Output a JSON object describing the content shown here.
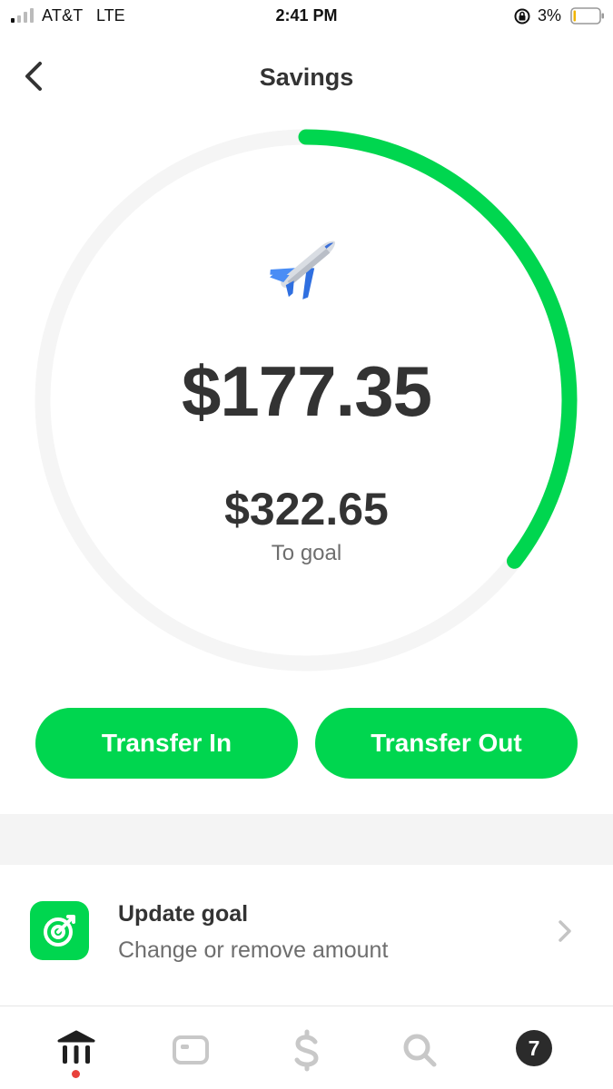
{
  "status_bar": {
    "carrier": "AT&T",
    "network": "LTE",
    "time": "2:41 PM",
    "battery_percent": "3%",
    "icons": [
      "signal-icon",
      "orientation-lock-icon",
      "battery-icon"
    ]
  },
  "header": {
    "title": "Savings",
    "back_icon": "chevron-left-icon"
  },
  "savings": {
    "goal_icon": "airplane-icon",
    "balance": "$177.35",
    "to_goal_amount": "$322.65",
    "to_goal_label": "To goal",
    "progress_fraction": 0.3547
  },
  "actions": {
    "transfer_in_label": "Transfer In",
    "transfer_out_label": "Transfer Out"
  },
  "update_goal": {
    "title": "Update goal",
    "subtitle": "Change or remove amount",
    "icon": "target-icon"
  },
  "tab_bar": {
    "items": [
      "home-icon",
      "card-icon",
      "dollar-icon",
      "search-icon",
      "activity-icon"
    ],
    "activity_badge": "7"
  },
  "colors": {
    "accent": "#00d64f",
    "ring_track": "#f5f5f5",
    "text_primary": "#333333",
    "text_secondary": "#6e6e6e",
    "notification_dot": "#e8413b"
  }
}
